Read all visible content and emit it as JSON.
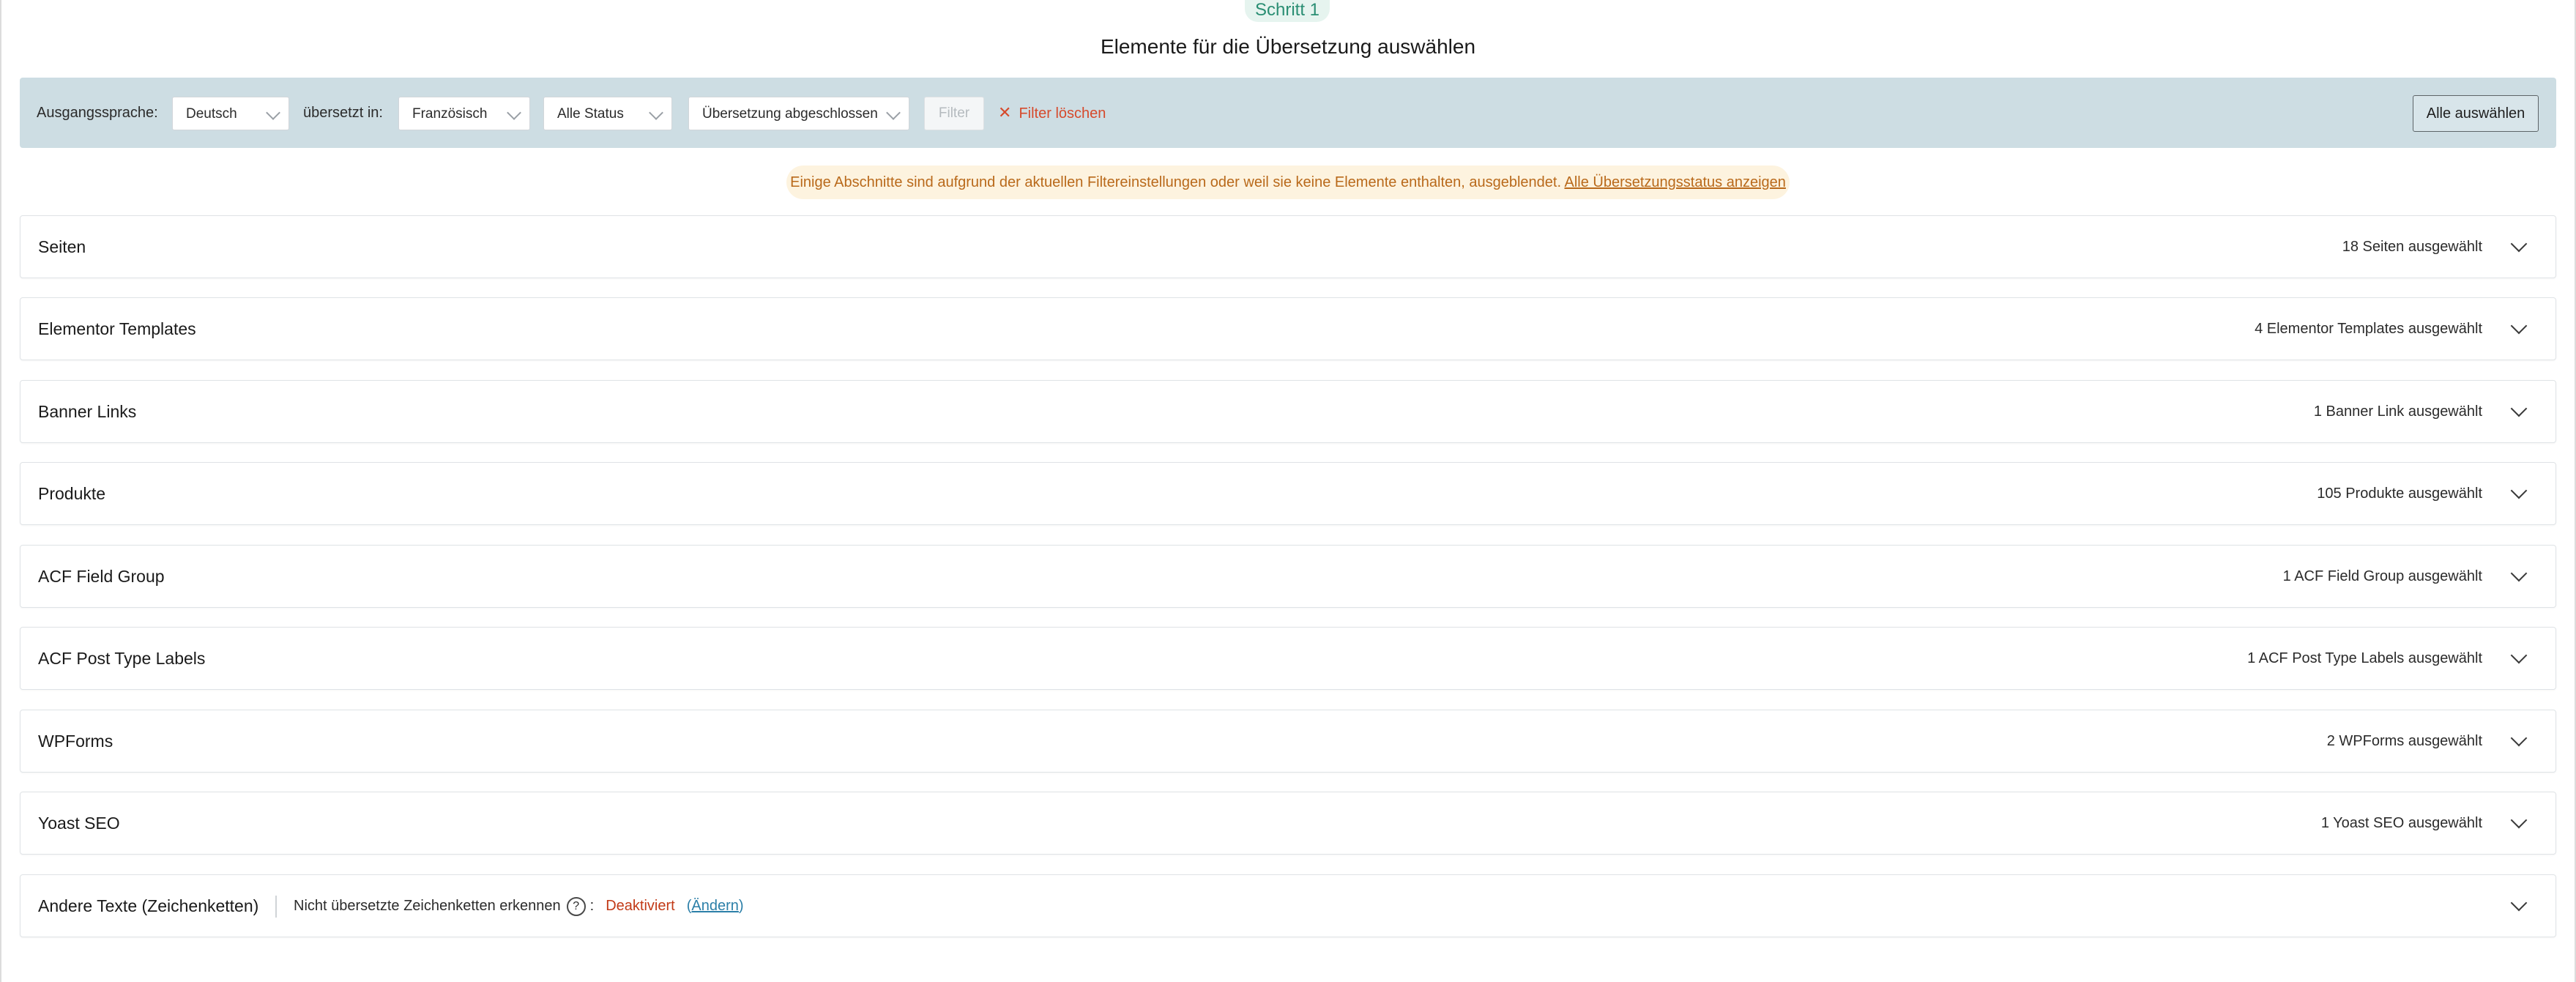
{
  "step": {
    "badge": "Schritt 1",
    "title": "Elemente für die Übersetzung auswählen"
  },
  "filter_bar": {
    "source_label": "Ausgangssprache:",
    "source_value": "Deutsch",
    "translated_label": "übersetzt in:",
    "target_value": "Französisch",
    "status_value": "Alle Status",
    "translation_status_value": "Übersetzung abgeschlossen",
    "filter_label": "Filter",
    "clear_label": "Filter löschen",
    "select_all_label": "Alle auswählen"
  },
  "notice": {
    "text": "Einige Abschnitte sind aufgrund der aktuellen Filtereinstellungen oder weil sie keine Elemente enthalten, ausgeblendet.",
    "link": "Alle Übersetzungsstatus anzeigen"
  },
  "sections": [
    {
      "title": "Seiten",
      "count": "18 Seiten ausgewählt"
    },
    {
      "title": "Elementor Templates",
      "count": "4 Elementor Templates ausgewählt"
    },
    {
      "title": "Banner Links",
      "count": "1 Banner Link ausgewählt"
    },
    {
      "title": "Produkte",
      "count": "105 Produkte ausgewählt"
    },
    {
      "title": "ACF Field Group",
      "count": "1 ACF Field Group ausgewählt"
    },
    {
      "title": "ACF Post Type Labels",
      "count": "1 ACF Post Type Labels ausgewählt"
    },
    {
      "title": "WPForms",
      "count": "2 WPForms ausgewählt"
    },
    {
      "title": "Yoast SEO",
      "count": "1 Yoast SEO ausgewählt"
    }
  ],
  "strings_section": {
    "title": "Andere Texte (Zeichenketten)",
    "detect_label": "Nicht übersetzte Zeichenketten erkennen",
    "help_glyph": "?",
    "colon": ":",
    "status": "Deaktiviert",
    "change_open": "(",
    "change_link": "Ändern",
    "change_close": ")"
  },
  "colors": {
    "accent_green": "#2a8e73",
    "filter_bar_bg": "#cddde3",
    "clear_red": "#d64a2c",
    "notice_bg": "#fdf3df",
    "notice_text": "#b9691a",
    "status_off": "#c23a17",
    "link_blue": "#2b7fa8"
  },
  "icons": {
    "dropdown": "chevron-down-icon",
    "clear": "close-icon",
    "expand": "chevron-down-icon",
    "help": "help-circle-icon"
  }
}
